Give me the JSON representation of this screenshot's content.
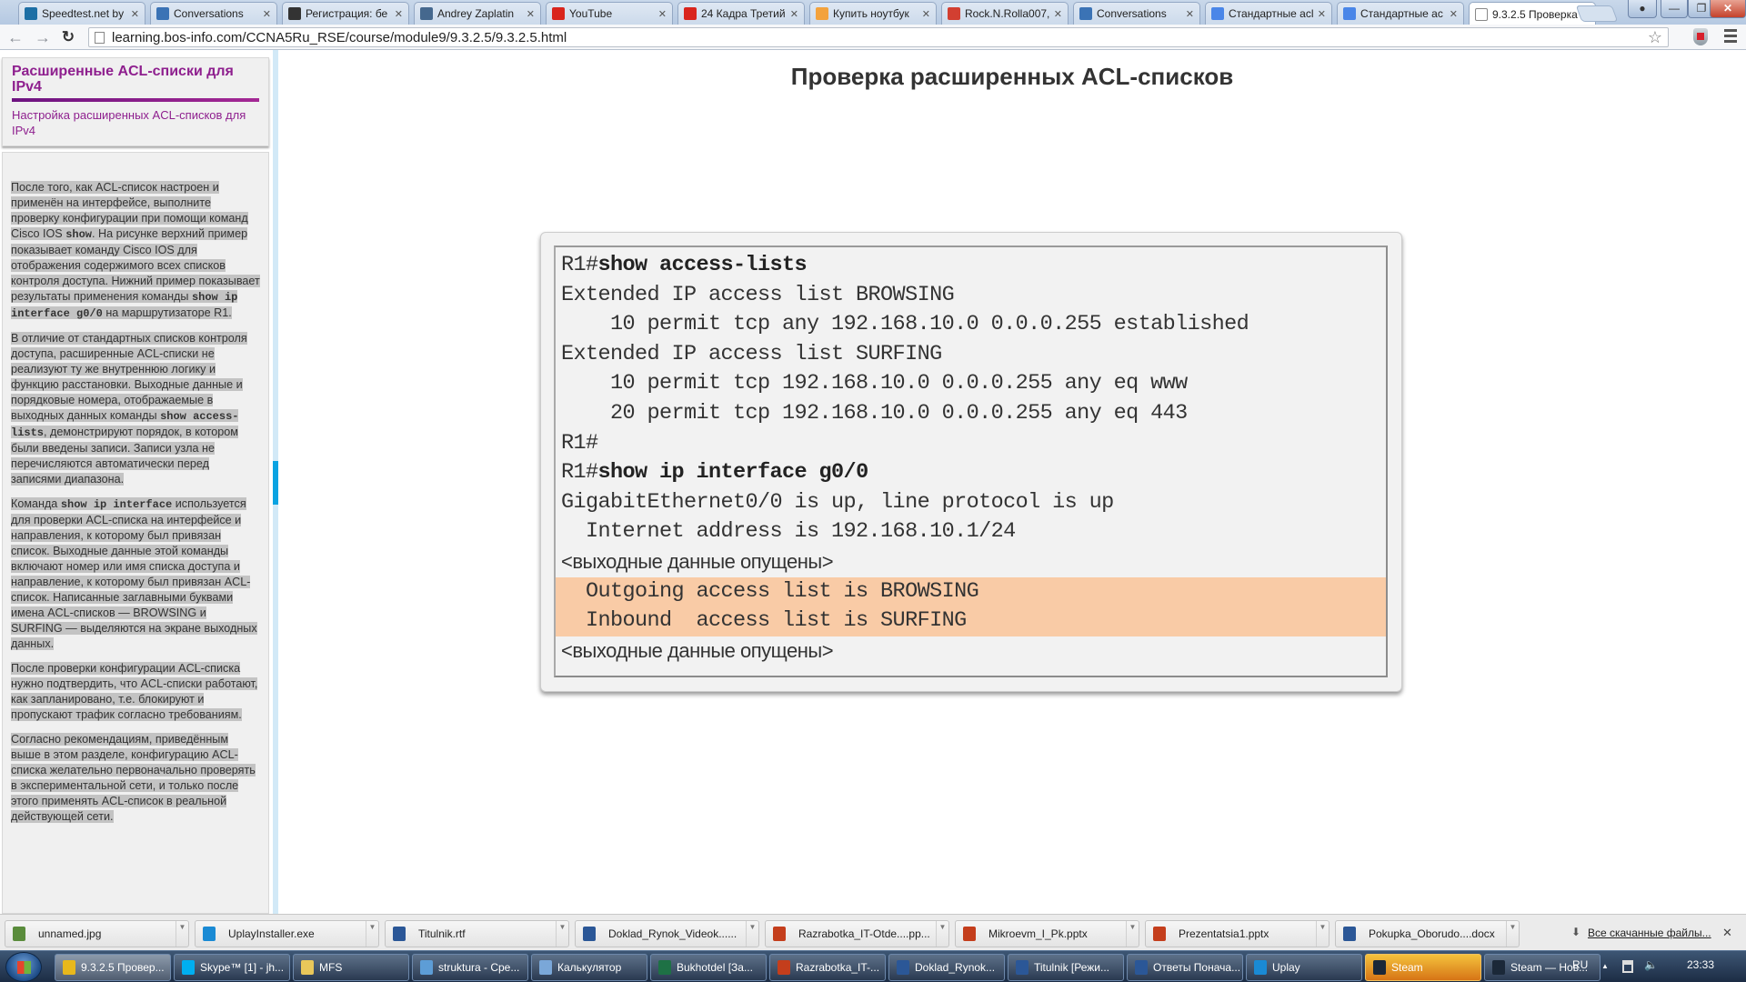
{
  "browser": {
    "tabs": [
      {
        "label": "Speedtest.net by",
        "icon": "speedtest-icon",
        "color": "#1d6fa5"
      },
      {
        "label": "Conversations",
        "icon": "chat-bubble-icon",
        "color": "#3b73b5"
      },
      {
        "label": "Регистрация: бе",
        "icon": "bank-icon",
        "color": "#333333"
      },
      {
        "label": "Andrey Zaplatin",
        "icon": "vk-icon",
        "color": "#45688e"
      },
      {
        "label": "YouTube",
        "icon": "youtube-icon",
        "color": "#d9251d"
      },
      {
        "label": "24 Кадра Третий",
        "icon": "youtube-icon",
        "color": "#d9251d"
      },
      {
        "label": "Купить ноутбук",
        "icon": "play-arrow-icon",
        "color": "#f3a23c"
      },
      {
        "label": "Rock.N.Rolla007,",
        "icon": "gmail-icon",
        "color": "#d23f31"
      },
      {
        "label": "Conversations",
        "icon": "chat-bubble-icon",
        "color": "#3b73b5"
      },
      {
        "label": "Стандартные acl",
        "icon": "google-icon",
        "color": "#4a86e8"
      },
      {
        "label": "Стандартные ac",
        "icon": "google-icon",
        "color": "#4a86e8"
      },
      {
        "label": "9.3.2.5 Проверка",
        "icon": "page-icon",
        "color": "#ffffff",
        "active": true
      }
    ],
    "url": "learning.bos-info.com/CCNA5Ru_RSE/course/module9/9.3.2.5/9.3.2.5.html"
  },
  "sidebar": {
    "title": "Расширенные ACL-списки для IPv4",
    "subtitle": "Настройка расширенных ACL-списков для IPv4",
    "paragraphs": [
      [
        {
          "t": "После того, как ACL-список настроен и применён на интерфейсе, выполните проверку конфигурации при помощи команд Cisco IOS "
        },
        {
          "c": "show"
        },
        {
          "t": ". На рисунке верхний пример показывает команду Cisco IOS для отображения содержимого всех списков контроля доступа. Нижний пример показывает результаты применения команды "
        },
        {
          "c": "show ip interface g0/0"
        },
        {
          "t": " на маршрутизаторе R1."
        }
      ],
      [
        {
          "t": "В отличие от стандартных списков контроля доступа, расширенные ACL-списки не реализуют ту же внутреннюю логику и функцию расстановки. Выходные данные и порядковые номера, отображаемые в выходных данных команды "
        },
        {
          "c": "show access-lists"
        },
        {
          "t": ", демонстрируют порядок, в котором были введены записи. Записи узла не перечисляются автоматически перед записями диапазона."
        }
      ],
      [
        {
          "t": "Команда "
        },
        {
          "c": "show ip interface"
        },
        {
          "t": " используется для проверки ACL-списка на интерфейсе и направления, к которому был привязан список. Выходные данные этой команды включают номер или имя списка доступа и направление, к которому был привязан ACL-список. Написанные заглавными буквами имена ACL-списков — BROWSING и SURFING — выделяются на экране выходных данных."
        }
      ],
      [
        {
          "t": "После проверки конфигурации ACL-списка нужно подтвердить, что ACL-списки работают, как запланировано, т.е. блокируют и пропускают трафик согласно требованиям."
        }
      ],
      [
        {
          "t": "Согласно рекомендациям, приведённым выше в этом разделе, конфигурацию ACL-списка желательно первоначально проверять в экспериментальной сети, и только после этого применять ACL-список в реальной действующей сети."
        }
      ]
    ]
  },
  "main": {
    "title": "Проверка расширенных ACL-списков",
    "terminal": [
      {
        "prompt": "R1#",
        "cmd": "show access-lists"
      },
      {
        "text": "Extended IP access list BROWSING"
      },
      {
        "text": "    10 permit tcp any 192.168.10.0 0.0.0.255 established"
      },
      {
        "text": "Extended IP access list SURFING"
      },
      {
        "text": "    10 permit tcp 192.168.10.0 0.0.0.255 any eq www"
      },
      {
        "text": "    20 permit tcp 192.168.10.0 0.0.0.255 any eq 443"
      },
      {
        "text": "R1#"
      },
      {
        "prompt": "R1#",
        "cmd": "show ip interface g0/0"
      },
      {
        "text": "GigabitEthernet0/0 is up, line protocol is up"
      },
      {
        "text": "  Internet address is 192.168.10.1/24"
      },
      {
        "note": "<выходные данные опущены>"
      },
      {
        "text": "  Outgoing access list is BROWSING",
        "highlight": true
      },
      {
        "text": "  Inbound  access list is SURFING",
        "highlight": true
      },
      {
        "note": "<выходные данные опущены>"
      }
    ],
    "highlight_color": "#f9cba6"
  },
  "downloads": {
    "items": [
      {
        "name": "unnamed.jpg",
        "icon": "image-file-icon",
        "color": "#5a8c3c"
      },
      {
        "name": "UplayInstaller.exe",
        "icon": "uplay-icon",
        "color": "#1a8ad4"
      },
      {
        "name": "Titulnik.rtf",
        "icon": "word-doc-icon",
        "color": "#2b5797"
      },
      {
        "name": "Doklad_Rynok_Videok......",
        "icon": "word-doc-icon",
        "color": "#2b5797"
      },
      {
        "name": "Razrabotka_IT-Otde....pp...",
        "icon": "powerpoint-icon",
        "color": "#c43e1c"
      },
      {
        "name": "Mikroevm_I_Pk.pptx",
        "icon": "powerpoint-icon",
        "color": "#c43e1c"
      },
      {
        "name": "Prezentatsia1.pptx",
        "icon": "powerpoint-icon",
        "color": "#c43e1c"
      },
      {
        "name": "Pokupka_Oborudo....docx",
        "icon": "word-doc-icon",
        "color": "#2b5797"
      }
    ],
    "show_all_label": "Все скачанные файлы..."
  },
  "taskbar": {
    "items": [
      {
        "label": "9.3.2.5 Провер...",
        "icon": "chrome-icon",
        "color": "#e8b81c",
        "active": true
      },
      {
        "label": "Skype™ [1] - jh...",
        "icon": "skype-icon",
        "color": "#00aff0"
      },
      {
        "label": "MFS",
        "icon": "folder-icon",
        "color": "#e9c75a"
      },
      {
        "label": "struktura - Сре...",
        "icon": "image-viewer-icon",
        "color": "#5d9dd6"
      },
      {
        "label": "Калькулятор",
        "icon": "calculator-icon",
        "color": "#7aa7d8"
      },
      {
        "label": "Bukhotdel  [За...",
        "icon": "excel-icon",
        "color": "#1e7145"
      },
      {
        "label": "Razrabotka_IT-...",
        "icon": "powerpoint-icon",
        "color": "#c43e1c"
      },
      {
        "label": "Doklad_Rynok...",
        "icon": "word-icon",
        "color": "#2b5797"
      },
      {
        "label": "Titulnik [Режи...",
        "icon": "word-icon",
        "color": "#2b5797"
      },
      {
        "label": "Ответы Понача...",
        "icon": "word-icon",
        "color": "#2b5797"
      },
      {
        "label": "Uplay",
        "icon": "uplay-icon",
        "color": "#1a8ad4"
      },
      {
        "label": "Steam",
        "icon": "steam-icon",
        "color": "#1b2838",
        "flash": true
      },
      {
        "label": "Steam — Нов...",
        "icon": "steam-icon",
        "color": "#1b2838"
      }
    ],
    "tray": {
      "language": "RU",
      "clock": "23:33"
    }
  }
}
